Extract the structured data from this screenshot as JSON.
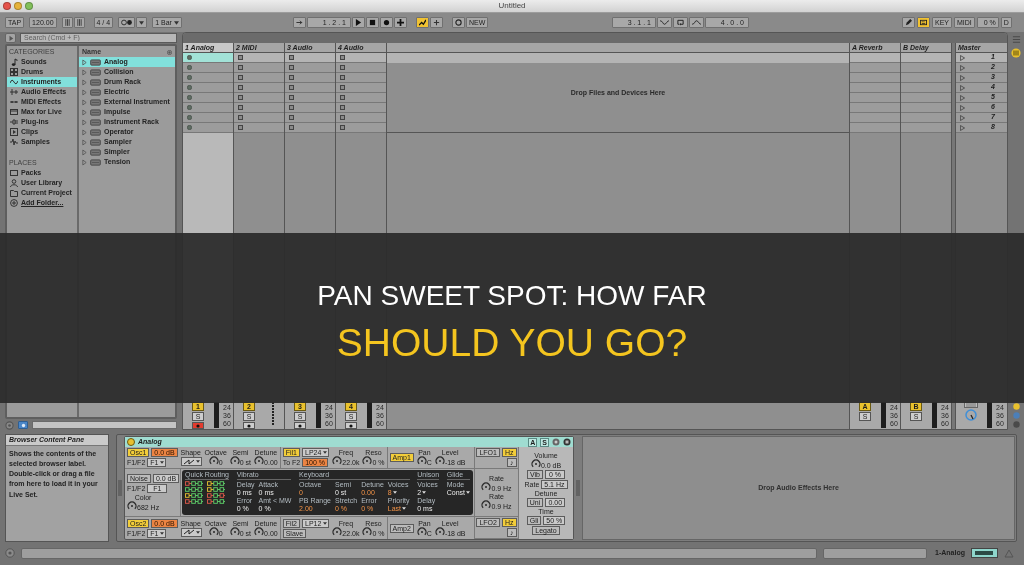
{
  "window": {
    "title": "Untitled"
  },
  "transport": {
    "tap": "TAP",
    "tempo": "120.00",
    "signature": "4 / 4",
    "quantization": "1 Bar",
    "position": "1 . 2 . 1",
    "controls": [
      {
        "on": false
      },
      {
        "on": false
      },
      {
        "on": false
      },
      {
        "on": false
      },
      {
        "on": true
      },
      {
        "on": false
      }
    ],
    "new_label": "NEW",
    "loop_start": "3 . 1 . 1",
    "loop_length": "4 . 0 . 0",
    "modes": [
      {
        "on": false
      },
      {
        "on": true
      }
    ],
    "key_label": "KEY",
    "midi_label": "MIDI",
    "cpu": "0 %",
    "disk": "D"
  },
  "browser": {
    "search_placeholder": "Search (Cmd + F)",
    "categories_title": "CATEGORIES",
    "categories": [
      {
        "label": "Sounds",
        "selected": false
      },
      {
        "label": "Drums",
        "selected": false
      },
      {
        "label": "Instruments",
        "selected": true
      },
      {
        "label": "Audio Effects",
        "selected": false
      },
      {
        "label": "MIDI Effects",
        "selected": false
      },
      {
        "label": "Max for Live",
        "selected": false
      },
      {
        "label": "Plug-ins",
        "selected": false
      },
      {
        "label": "Clips",
        "selected": false
      },
      {
        "label": "Samples",
        "selected": false
      }
    ],
    "places_title": "PLACES",
    "places": [
      {
        "label": "Packs",
        "kind": "place",
        "selected": false
      },
      {
        "label": "User Library",
        "kind": "place",
        "selected": false
      },
      {
        "label": "Current Project",
        "kind": "place",
        "selected": false
      },
      {
        "label": "Add Folder...",
        "kind": "link",
        "selected": false
      }
    ],
    "name_header": "Name",
    "items": [
      {
        "label": "Analog",
        "selected": true
      },
      {
        "label": "Collision",
        "selected": false
      },
      {
        "label": "Drum Rack",
        "selected": false
      },
      {
        "label": "Electric",
        "selected": false
      },
      {
        "label": "External Instrument",
        "selected": false
      },
      {
        "label": "Impulse",
        "selected": false
      },
      {
        "label": "Instrument Rack",
        "selected": false
      },
      {
        "label": "Operator",
        "selected": false
      },
      {
        "label": "Sampler",
        "selected": false
      },
      {
        "label": "Simpler",
        "selected": false
      },
      {
        "label": "Tension",
        "selected": false
      }
    ]
  },
  "session": {
    "tracks": [
      {
        "name": "1 Analog",
        "selected": true,
        "armed": true,
        "meter": true,
        "activator": "1",
        "solo": "S",
        "scale": [
          "24",
          "36",
          "60"
        ]
      },
      {
        "name": "2 MIDI",
        "selected": false,
        "armed": false,
        "meter": false,
        "activator": "2",
        "solo": "S"
      },
      {
        "name": "3 Audio",
        "selected": false,
        "armed": false,
        "meter": true,
        "activator": "3",
        "solo": "S",
        "scale": [
          "24",
          "36",
          "60"
        ]
      },
      {
        "name": "4 Audio",
        "selected": false,
        "armed": false,
        "meter": true,
        "activator": "4",
        "solo": "S",
        "scale": [
          "24",
          "36",
          "60"
        ]
      }
    ],
    "drop_hint": "Drop Files and Devices Here",
    "returns": [
      {
        "name": "A Reverb",
        "activator": "A",
        "solo": "S",
        "scale": [
          "24",
          "36",
          "60"
        ]
      },
      {
        "name": "B Delay",
        "activator": "B",
        "solo": "S",
        "scale": [
          "24",
          "36",
          "60"
        ]
      }
    ],
    "master": {
      "name": "Master",
      "scale": [
        "24",
        "36",
        "60"
      ]
    },
    "scenes": [
      {
        "label": "1",
        "selected": true
      },
      {
        "label": "2",
        "selected": false
      },
      {
        "label": "3",
        "selected": false
      },
      {
        "label": "4",
        "selected": false
      },
      {
        "label": "5",
        "selected": false
      },
      {
        "label": "6",
        "selected": false
      },
      {
        "label": "7",
        "selected": false
      },
      {
        "label": "8",
        "selected": false
      }
    ]
  },
  "headline": {
    "lines": [
      {
        "text": "PAN SWEET SPOT: HOW FAR",
        "highlight": false
      },
      {
        "text": "SHOULD YOU GO?",
        "highlight": true
      }
    ]
  },
  "info": {
    "title": "Browser Content Pane",
    "text": "Shows the contents of the selected browser label. Double-click or drag a file from here to load it in your Live Set."
  },
  "device": {
    "title": "Analog",
    "on": true,
    "header_buttons": [
      "A",
      "S"
    ],
    "top": [
      [
        [
          [
            {
              "kind": "button",
              "label": "Osc1",
              "on": true
            },
            {
              "kind": "field",
              "value": "0.0 dB",
              "accent": true
            }
          ],
          [
            {
              "kind": "text",
              "label": "F1/F2"
            },
            {
              "kind": "dropdown",
              "value": "F1"
            }
          ]
        ],
        [
          [
            {
              "kind": "text",
              "label": "Shape"
            }
          ],
          [
            {
              "kind": "wave"
            }
          ]
        ],
        [
          [
            {
              "kind": "knob",
              "label": "Octave",
              "value": "0"
            }
          ]
        ],
        [
          [
            {
              "kind": "knob",
              "label": "Semi",
              "value": "0 st"
            }
          ]
        ],
        [
          [
            {
              "kind": "knob",
              "label": "Detune",
              "value": "0.00"
            }
          ]
        ]
      ],
      [
        [
          [
            {
              "kind": "button",
              "label": "Fil1",
              "on": true
            },
            {
              "kind": "dropdown",
              "value": "LP24"
            }
          ],
          [
            {
              "kind": "text",
              "label": "To F2"
            },
            {
              "kind": "field",
              "value": "100 %",
              "accent": true
            }
          ]
        ],
        [
          [
            {
              "kind": "knob",
              "label": "Freq",
              "value": "22.0k"
            }
          ]
        ],
        [
          [
            {
              "kind": "knob",
              "label": "Reso",
              "value": "0 %"
            }
          ]
        ]
      ],
      [
        [
          [
            {
              "kind": "button",
              "label": "Amp1",
              "on": true
            }
          ]
        ],
        [
          [
            {
              "kind": "knob",
              "label": "Pan",
              "value": "C"
            }
          ]
        ],
        [
          [
            {
              "kind": "knob",
              "label": "Level",
              "value": "-18 dB"
            }
          ]
        ]
      ]
    ],
    "noise": [
      [
        {
          "kind": "button",
          "label": "Noise",
          "on": false
        },
        {
          "kind": "field",
          "value": "0.0 dB",
          "accent": false
        }
      ],
      [
        {
          "kind": "text",
          "label": "F1/F2"
        },
        {
          "kind": "field",
          "value": "F1",
          "accent": false
        }
      ],
      [
        {
          "kind": "knob",
          "label": "Color",
          "value": "682 Hz"
        }
      ]
    ],
    "display": {
      "routing_title": "Quick Routing",
      "sections": [
        {
          "title": "Vibrato",
          "columns": [
            [
              {
                "label": "Delay",
                "value": "0 ms",
                "accent": false,
                "menu": false
              },
              {
                "label": "Error",
                "value": "0 %",
                "accent": false,
                "menu": false
              }
            ],
            [
              {
                "label": "Attack",
                "value": "0 ms",
                "accent": false,
                "menu": false
              },
              {
                "label": "Amt < MW",
                "value": "0 %",
                "accent": false,
                "menu": false
              }
            ]
          ]
        },
        {
          "title": "Keyboard",
          "columns": [
            [
              {
                "label": "Octave",
                "value": "0",
                "accent": true,
                "menu": false
              },
              {
                "label": "PB Range",
                "value": "2.00",
                "accent": true,
                "menu": false
              }
            ],
            [
              {
                "label": "Semi",
                "value": "0 st",
                "accent": false,
                "menu": false
              },
              {
                "label": "Stretch",
                "value": "0 %",
                "accent": true,
                "menu": false
              }
            ],
            [
              {
                "label": "Detune",
                "value": "0.00",
                "accent": true,
                "menu": false
              },
              {
                "label": "Error",
                "value": "0 %",
                "accent": true,
                "menu": false
              }
            ],
            [
              {
                "label": "Voices",
                "value": "8",
                "accent": true,
                "menu": true
              },
              {
                "label": "Priority",
                "value": "Last",
                "accent": true,
                "menu": true
              }
            ]
          ]
        },
        {
          "title": "Unison",
          "columns": [
            [
              {
                "label": "Voices",
                "value": "2",
                "accent": false,
                "menu": true
              },
              {
                "label": "Delay",
                "value": "0 ms",
                "accent": false,
                "menu": false
              }
            ]
          ]
        },
        {
          "title": "Glide",
          "columns": [
            [
              {
                "label": "Mode",
                "value": "Const",
                "accent": false,
                "menu": true
              }
            ]
          ]
        }
      ]
    },
    "bottom": [
      [
        [
          [
            {
              "kind": "button",
              "label": "Osc2",
              "on": true
            },
            {
              "kind": "field",
              "value": "0.0 dB",
              "accent": true
            }
          ],
          [
            {
              "kind": "text",
              "label": "F1/F2"
            },
            {
              "kind": "dropdown",
              "value": "F1"
            }
          ]
        ],
        [
          [
            {
              "kind": "text",
              "label": "Shape"
            }
          ],
          [
            {
              "kind": "wave"
            }
          ]
        ],
        [
          [
            {
              "kind": "knob",
              "label": "Octave",
              "value": "0"
            }
          ]
        ],
        [
          [
            {
              "kind": "knob",
              "label": "Semi",
              "value": "0 st"
            }
          ]
        ],
        [
          [
            {
              "kind": "knob",
              "label": "Detune",
              "value": "0.00"
            }
          ]
        ]
      ],
      [
        [
          [
            {
              "kind": "button",
              "label": "Fil2",
              "on": false
            },
            {
              "kind": "dropdown",
              "value": "LP12"
            }
          ],
          [
            {
              "kind": "button",
              "label": "Slave",
              "on": false
            }
          ]
        ],
        [
          [
            {
              "kind": "knob",
              "label": "Freq",
              "value": "22.0k"
            }
          ]
        ],
        [
          [
            {
              "kind": "knob",
              "label": "Reso",
              "value": "0 %"
            }
          ]
        ]
      ],
      [
        [
          [
            {
              "kind": "button",
              "label": "Amp2",
              "on": false
            }
          ]
        ],
        [
          [
            {
              "kind": "knob",
              "label": "Pan",
              "value": "C"
            }
          ]
        ],
        [
          [
            {
              "kind": "knob",
              "label": "Level",
              "value": "-18 dB"
            }
          ]
        ]
      ]
    ],
    "lfo1": [
      [
        {
          "kind": "button",
          "label": "LFO1",
          "on": false
        },
        {
          "kind": "button",
          "label": "Hz",
          "on": true
        }
      ],
      [
        {
          "kind": "button",
          "label": "♪",
          "on": false
        }
      ]
    ],
    "lfo_rates": [
      [
        {
          "kind": "knob",
          "label": "Rate",
          "value": "0.9 Hz"
        }
      ],
      [
        {
          "kind": "knob",
          "label": "Rate",
          "value": "0.9 Hz"
        }
      ]
    ],
    "lfo2": [
      [
        {
          "kind": "button",
          "label": "LFO2",
          "on": false
        },
        {
          "kind": "button",
          "label": "Hz",
          "on": true
        }
      ],
      [
        {
          "kind": "button",
          "label": "♪",
          "on": false
        }
      ]
    ],
    "global": [
      [
        {
          "kind": "knob",
          "label": "Volume",
          "value": "0.0 dB"
        }
      ],
      [
        {
          "kind": "button",
          "label": "Vib",
          "on": false
        },
        {
          "kind": "field",
          "value": "0 %",
          "accent": false
        }
      ],
      [
        {
          "kind": "text",
          "label": "Rate"
        },
        {
          "kind": "field",
          "value": "5.1 Hz",
          "accent": false
        }
      ],
      [
        {
          "kind": "text",
          "label": "Detune"
        }
      ],
      [
        {
          "kind": "button",
          "label": "Uni",
          "on": false
        },
        {
          "kind": "field",
          "value": "0.00",
          "accent": false
        }
      ],
      [
        {
          "kind": "text",
          "label": "Time"
        }
      ],
      [
        {
          "kind": "button",
          "label": "Gli",
          "on": false
        },
        {
          "kind": "field",
          "value": "50 %",
          "accent": false
        }
      ],
      [
        {
          "kind": "button",
          "label": "Legato",
          "on": false
        }
      ]
    ]
  },
  "device_chain": {
    "drop_hint": "Drop Audio Effects Here"
  },
  "status": {
    "track": "1-Analog"
  }
}
